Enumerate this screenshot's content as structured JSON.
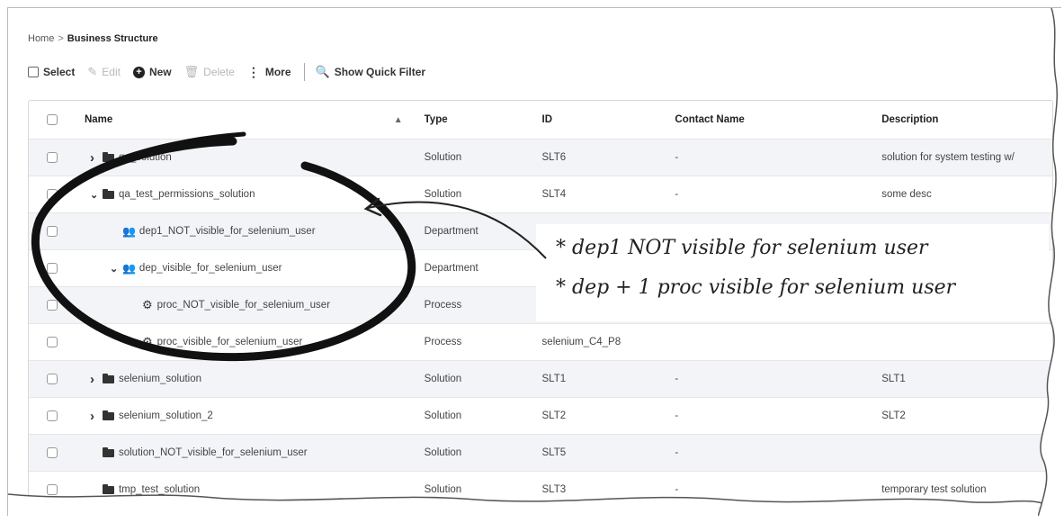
{
  "breadcrumb": {
    "home": "Home",
    "separator": ">",
    "current": "Business Structure"
  },
  "toolbar": {
    "select_label": "Select",
    "edit_label": "Edit",
    "new_label": "New",
    "delete_label": "Delete",
    "more_label": "More",
    "quick_filter_label": "Show Quick Filter"
  },
  "table": {
    "headers": {
      "name": "Name",
      "type": "Type",
      "id": "ID",
      "contact": "Contact Name",
      "description": "Description"
    },
    "rows": [
      {
        "name": "qa_solution",
        "type": "Solution",
        "id": "SLT6",
        "contact": "-",
        "description": "solution for system testing w/",
        "icon": "folder-icon",
        "expander": ">"
      },
      {
        "name": "qa_test_permissions_solution",
        "type": "Solution",
        "id": "SLT4",
        "contact": "-",
        "description": "some desc",
        "icon": "folder-icon",
        "expander": "v"
      },
      {
        "name": "dep1_NOT_visible_for_selenium_user",
        "type": "Department",
        "id": "",
        "contact": "",
        "description": "",
        "icon": "department-icon",
        "expander": ""
      },
      {
        "name": "dep_visible_for_selenium_user",
        "type": "Department",
        "id": "",
        "contact": "",
        "description": "",
        "icon": "department-icon",
        "expander": "v"
      },
      {
        "name": "proc_NOT_visible_for_selenium_user",
        "type": "Process",
        "id": "",
        "contact": "",
        "description": "",
        "icon": "gear-icon",
        "expander": ""
      },
      {
        "name": "proc_visible_for_selenium_user",
        "type": "Process",
        "id": "selenium_C4_P8",
        "contact": "",
        "description": "",
        "icon": "gear-icon",
        "expander": ""
      },
      {
        "name": "selenium_solution",
        "type": "Solution",
        "id": "SLT1",
        "contact": "-",
        "description": "SLT1",
        "icon": "folder-icon",
        "expander": ">"
      },
      {
        "name": "selenium_solution_2",
        "type": "Solution",
        "id": "SLT2",
        "contact": "-",
        "description": "SLT2",
        "icon": "folder-icon",
        "expander": ">"
      },
      {
        "name": "solution_NOT_visible_for_selenium_user",
        "type": "Solution",
        "id": "SLT5",
        "contact": "-",
        "description": "",
        "icon": "folder-icon",
        "expander": ""
      },
      {
        "name": "tmp_test_solution",
        "type": "Solution",
        "id": "SLT3",
        "contact": "-",
        "description": "temporary test solution",
        "icon": "folder-icon",
        "expander": ""
      }
    ]
  },
  "annotation": {
    "line1": "* dep1 NOT visible for selenium user",
    "line2": "* dep + 1 proc visible for selenium user"
  }
}
